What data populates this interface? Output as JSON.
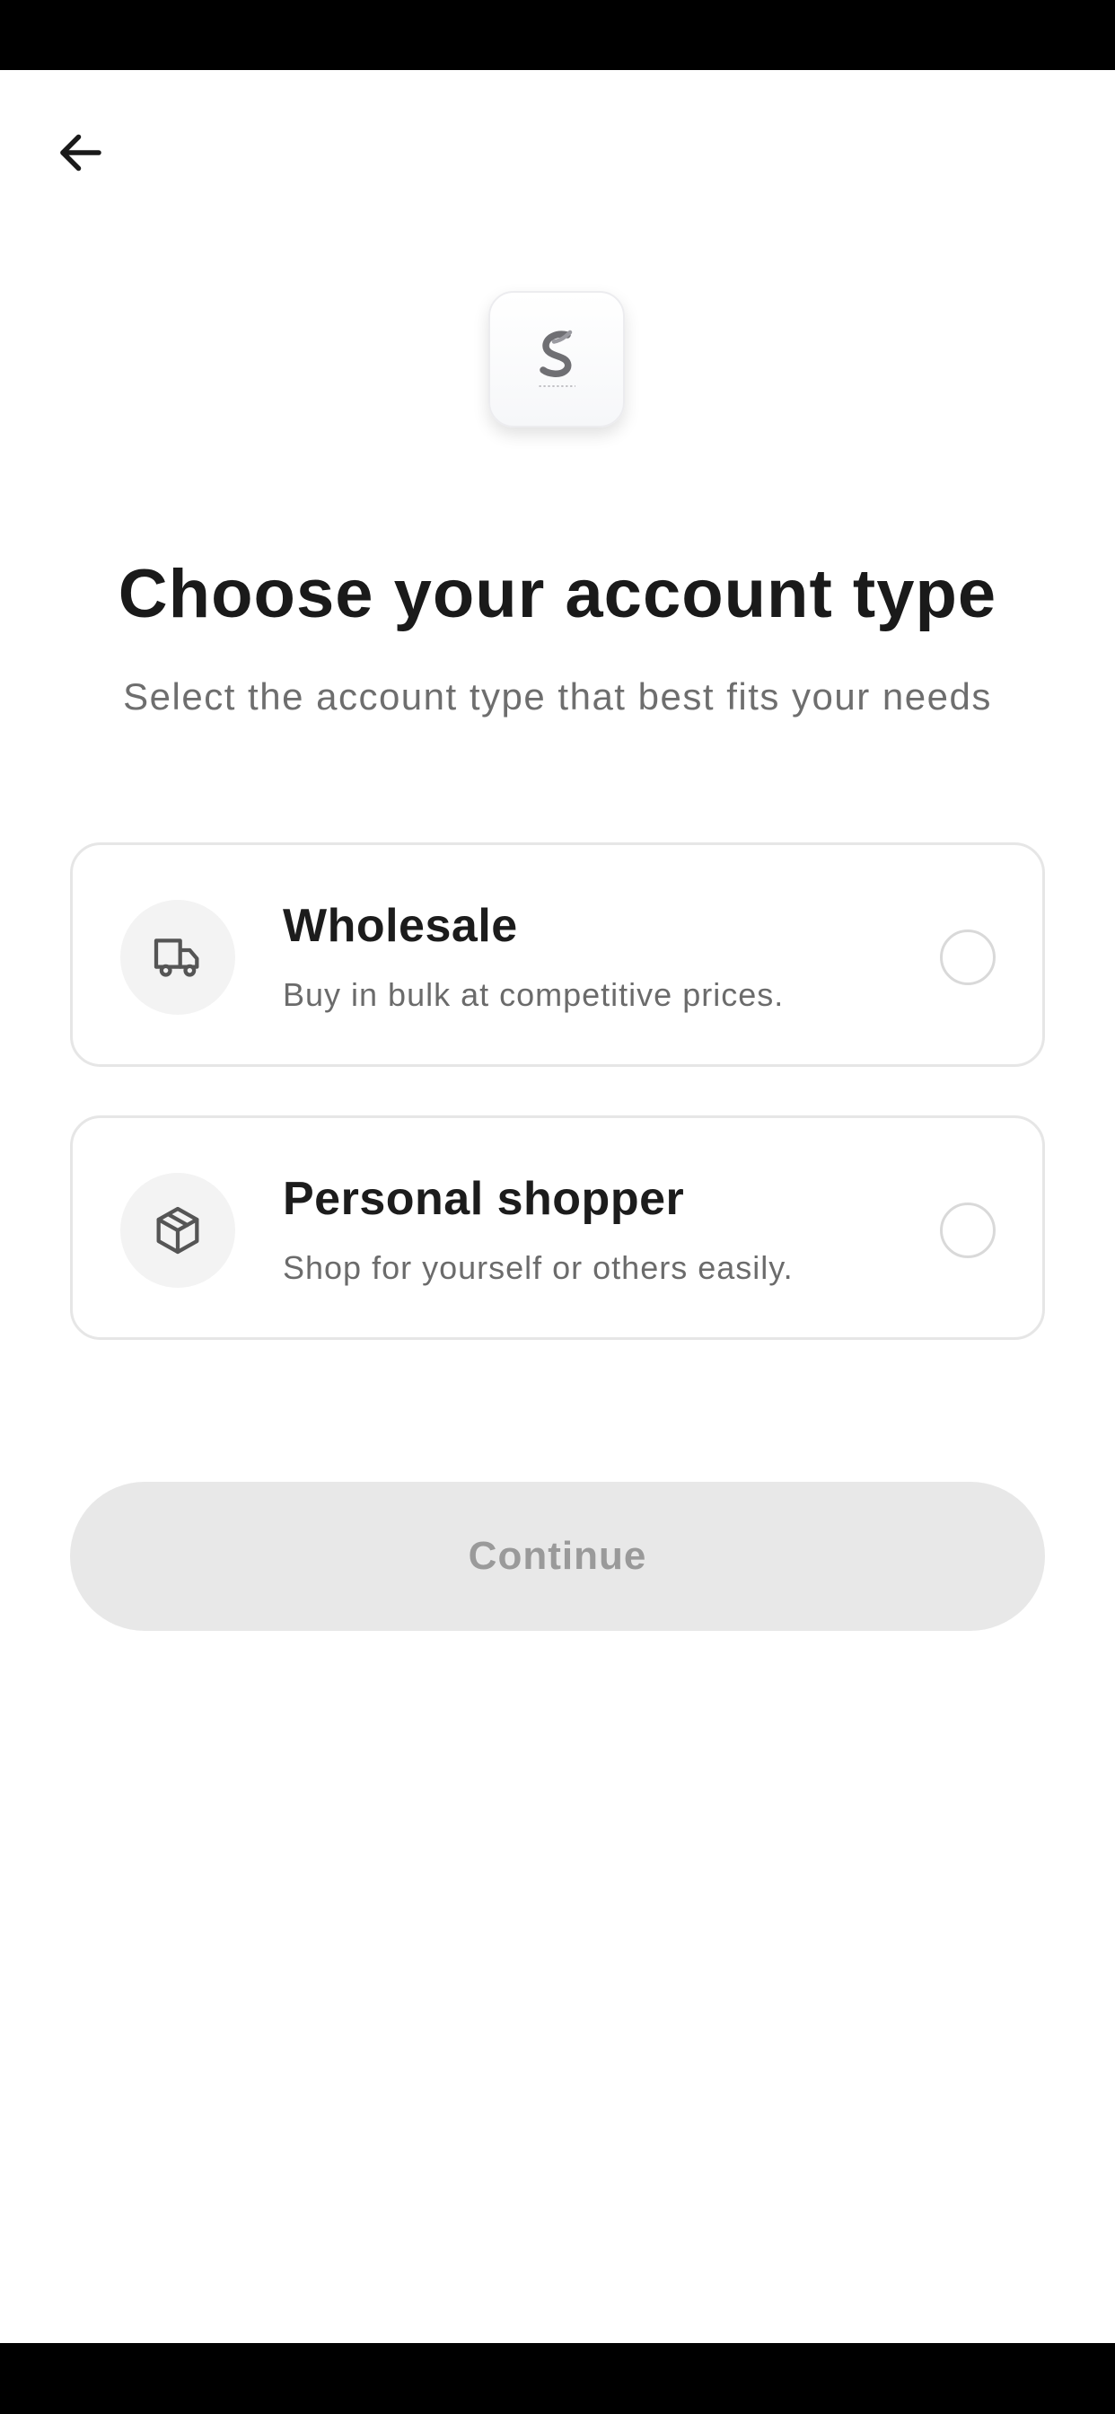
{
  "header": {
    "back_icon": "arrow-left-icon"
  },
  "logo": {
    "icon": "brand-s-logo-icon",
    "brand_color": "#6f6f73"
  },
  "title": "Choose your account type",
  "subtitle": "Select the account type that best fits your needs",
  "options": [
    {
      "id": "wholesale",
      "icon": "truck-icon",
      "title": "Wholesale",
      "description": "Buy in bulk at competitive prices.",
      "selected": false
    },
    {
      "id": "personal-shopper",
      "icon": "package-box-icon",
      "title": "Personal shopper",
      "description": "Shop for yourself or others easily.",
      "selected": false
    }
  ],
  "continue_button": {
    "label": "Continue",
    "enabled": false,
    "background": "#e8e8e8",
    "text_color": "#9a9a9a"
  },
  "colors": {
    "title": "#1a1a1a",
    "subtitle": "#6e6e6e",
    "card_border": "#e6e6e6",
    "icon_bg": "#f3f3f3"
  }
}
